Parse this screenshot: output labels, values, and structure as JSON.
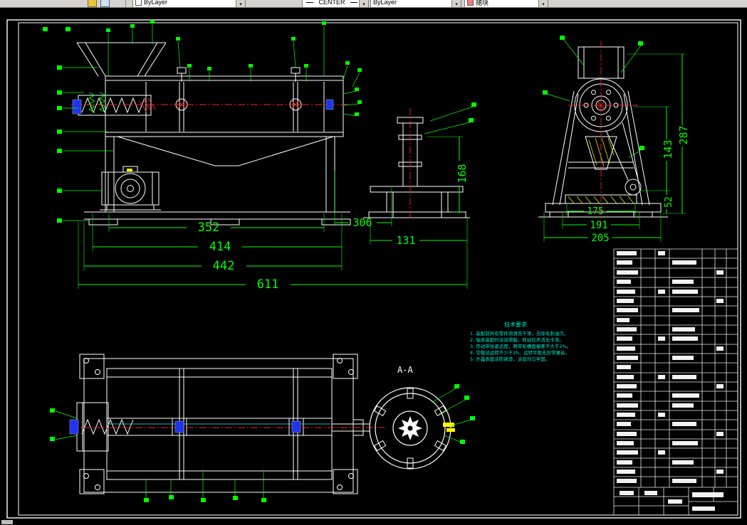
{
  "toolbar": {
    "color_control": "ByLayer",
    "linetype_control": "CENTER",
    "lineweight_control": "ByLayer",
    "plotstyle_control": "随块"
  },
  "drawing": {
    "section_label": "A-A",
    "tech_notes": {
      "title": "技术要求",
      "lines": [
        "1. 装配前所有零件须清洗干净，去除毛刺油污。",
        "2. 轴承装配时涂润滑脂，转动应灵活无卡滞。",
        "3. 传动带张紧适度，两带轮槽面偏差不大于2%。",
        "4. 空载试运转不少于2h，运转平稳无异常噪音。",
        "5. 外露表面涂防锈漆，涂层均匀牢固。"
      ]
    },
    "dimensions": {
      "front": {
        "d352": "352",
        "d414": "414",
        "d442": "442",
        "d611": "611",
        "d306": "306",
        "d131": "131",
        "d168": "168"
      },
      "side": {
        "d287": "287",
        "d143": "143",
        "d52": "52",
        "d175": "175",
        "d191": "191",
        "d205": "205"
      }
    }
  },
  "colors": {
    "dimension": "#00ff00",
    "geometry": "#ffffff",
    "centerline": "#ff2222",
    "accent_blue": "#2233ee",
    "accent_yellow": "#ffff00",
    "notes": "#00e5cc",
    "canvas": "#000000"
  }
}
